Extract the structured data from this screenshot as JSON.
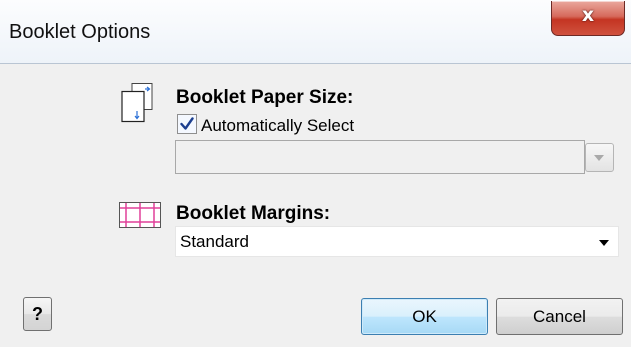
{
  "window": {
    "title": "Booklet Options",
    "close_icon": "close-x-icon",
    "close_glyph": "x"
  },
  "paper_size": {
    "icon": "paper-size-icon",
    "label": "Booklet Paper Size:",
    "auto_select_label": "Automatically Select",
    "auto_select_checked": true,
    "value": "",
    "disabled": true
  },
  "margins": {
    "icon": "margins-grid-icon",
    "label": "Booklet Margins:",
    "value": "Standard"
  },
  "buttons": {
    "help": "?",
    "ok": "OK",
    "cancel": "Cancel"
  },
  "colors": {
    "close_red": "#c43522",
    "margin_lines": "#e0409a",
    "ok_border": "#3c7fb1"
  }
}
